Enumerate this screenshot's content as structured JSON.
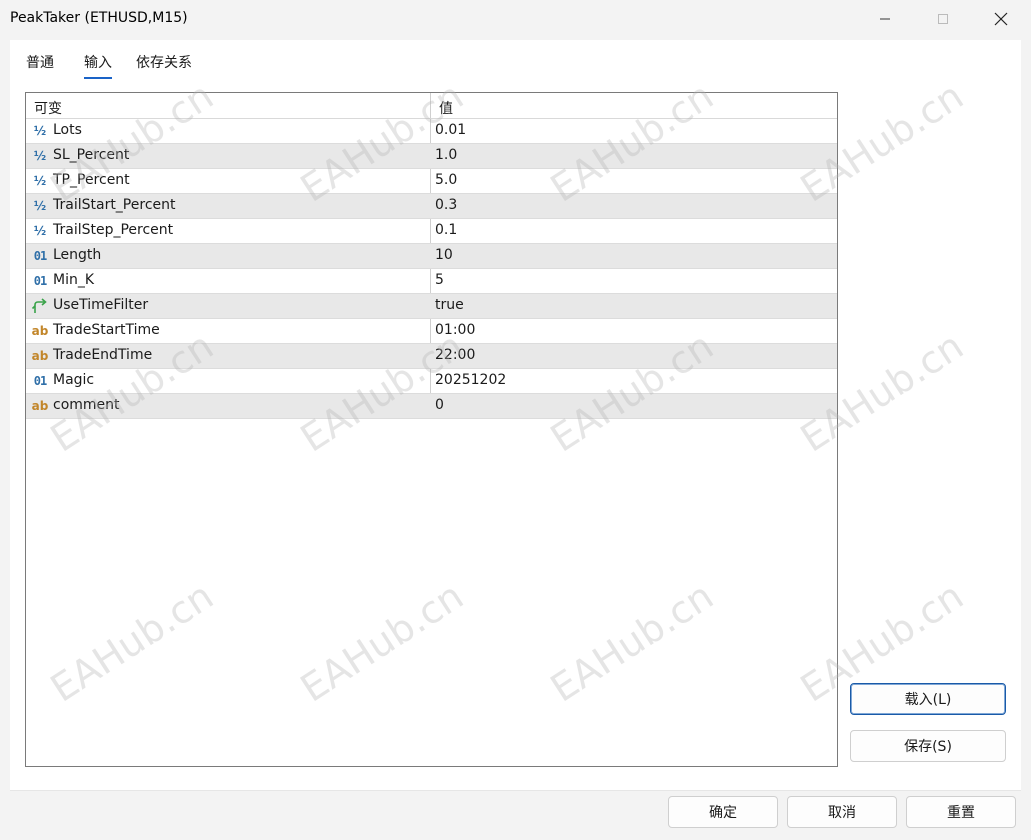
{
  "window": {
    "title": "PeakTaker (ETHUSD,M15)"
  },
  "tabs": [
    {
      "label": "普通"
    },
    {
      "label": "输入"
    },
    {
      "label": "依存关系"
    }
  ],
  "grid": {
    "headers": {
      "variable": "可变",
      "value": "值"
    },
    "rows": [
      {
        "icon": "fraction-icon",
        "name": "Lots",
        "value": "0.01"
      },
      {
        "icon": "fraction-icon",
        "name": "SL_Percent",
        "value": "1.0"
      },
      {
        "icon": "fraction-icon",
        "name": "TP_Percent",
        "value": "5.0"
      },
      {
        "icon": "fraction-icon",
        "name": "TrailStart_Percent",
        "value": "0.3"
      },
      {
        "icon": "fraction-icon",
        "name": "TrailStep_Percent",
        "value": "0.1"
      },
      {
        "icon": "integer-icon",
        "name": "Length",
        "value": "10"
      },
      {
        "icon": "integer-icon",
        "name": "Min_K",
        "value": "5"
      },
      {
        "icon": "boolean-icon",
        "name": "UseTimeFilter",
        "value": "true"
      },
      {
        "icon": "string-icon",
        "name": "TradeStartTime",
        "value": "01:00"
      },
      {
        "icon": "string-icon",
        "name": "TradeEndTime",
        "value": "22:00"
      },
      {
        "icon": "integer-icon",
        "name": "Magic",
        "value": "20251202"
      },
      {
        "icon": "string-icon",
        "name": "comment",
        "value": "0"
      }
    ]
  },
  "side_buttons": {
    "load": "载入(L)",
    "save": "保存(S)"
  },
  "footer": {
    "ok": "确定",
    "cancel": "取消",
    "reset": "重置"
  },
  "icon_glyphs": {
    "fraction": "½",
    "integer": "01",
    "string": "ab"
  },
  "watermark": "EAHub.cn",
  "colors": {
    "accent": "#1a63c7",
    "numeric_icon": "#2f6fa8",
    "string_icon": "#c2862a",
    "boolean_icon": "#3aa34a",
    "alt_row": "#e8e8e8"
  }
}
